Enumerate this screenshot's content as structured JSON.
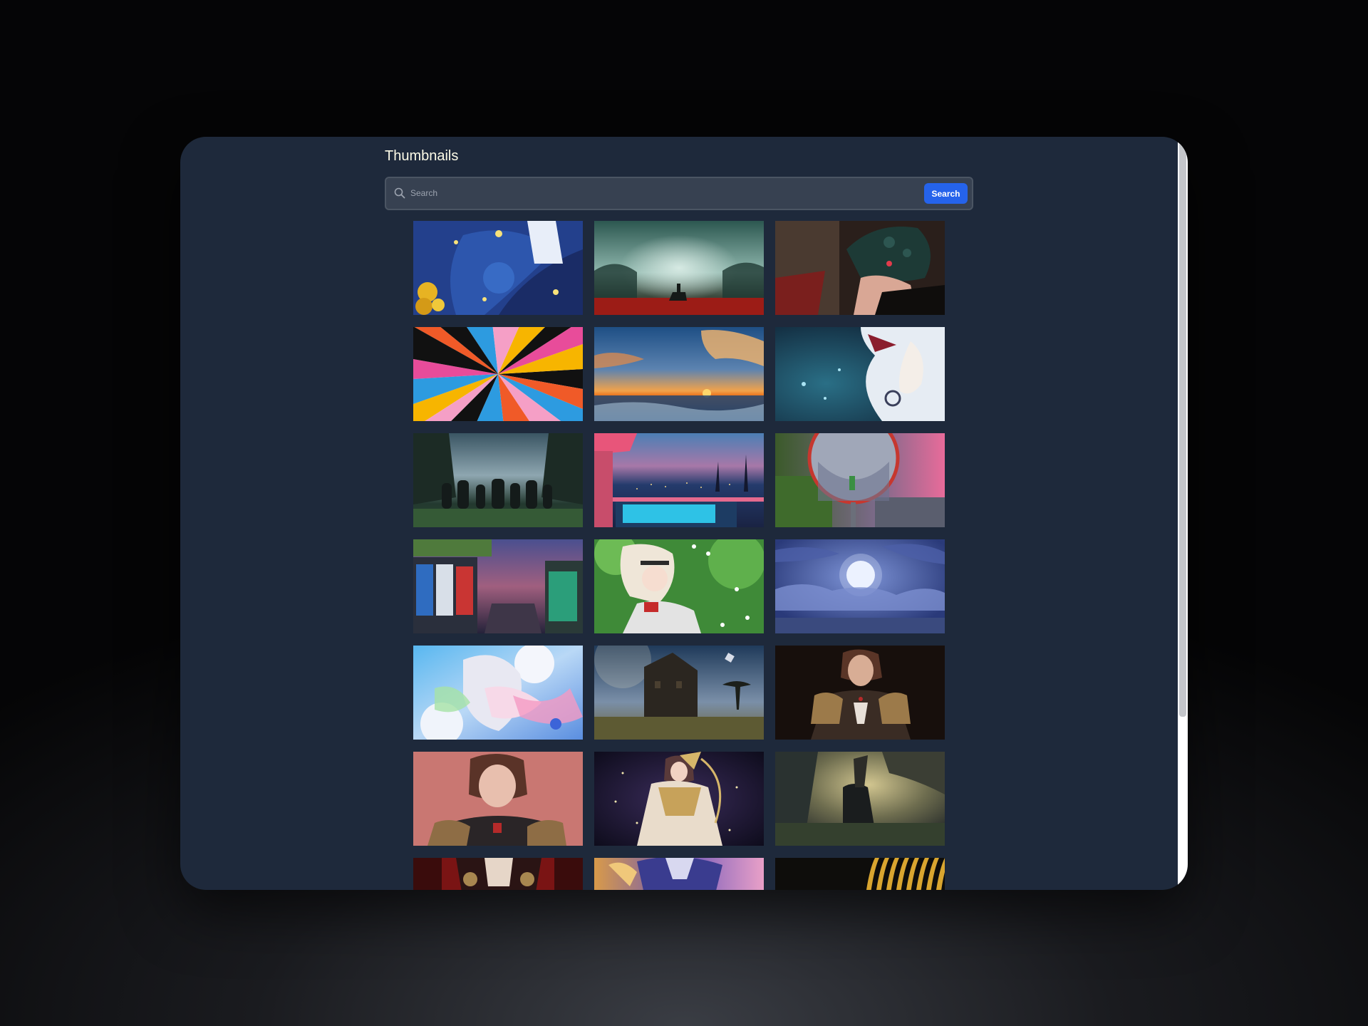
{
  "page": {
    "title": "Thumbnails"
  },
  "search": {
    "placeholder": "Search",
    "value": "",
    "button_label": "Search",
    "icon": "search-icon"
  },
  "colors": {
    "window_background": "#1e293b",
    "title": "#fefce8",
    "search_field_background": "#374151",
    "search_button": "#2563eb",
    "scrollbar": "#c4c6ca"
  },
  "thumbnails": [
    {
      "name": "thumbnail-starry-girl-sunflowers"
    },
    {
      "name": "thumbnail-horse-rider-red-field"
    },
    {
      "name": "thumbnail-hand-gamepad"
    },
    {
      "name": "thumbnail-colorful-sunburst"
    },
    {
      "name": "thumbnail-ocean-sunset"
    },
    {
      "name": "thumbnail-white-haired-girl"
    },
    {
      "name": "thumbnail-group-forest-night"
    },
    {
      "name": "thumbnail-poolside-city-view"
    },
    {
      "name": "thumbnail-convex-mirror-street"
    },
    {
      "name": "thumbnail-vending-machines-alley"
    },
    {
      "name": "thumbnail-anime-girl-green-flowers"
    },
    {
      "name": "thumbnail-full-moon-clouds"
    },
    {
      "name": "thumbnail-pastel-anime-girl"
    },
    {
      "name": "thumbnail-mansion-field"
    },
    {
      "name": "thumbnail-armored-woman-dark"
    },
    {
      "name": "thumbnail-armored-woman-pink"
    },
    {
      "name": "thumbnail-golden-warrior-archer"
    },
    {
      "name": "thumbnail-knight-on-cliff"
    },
    {
      "name": "thumbnail-red-armor"
    },
    {
      "name": "thumbnail-purple-fantasy"
    },
    {
      "name": "thumbnail-gold-stripes"
    }
  ]
}
